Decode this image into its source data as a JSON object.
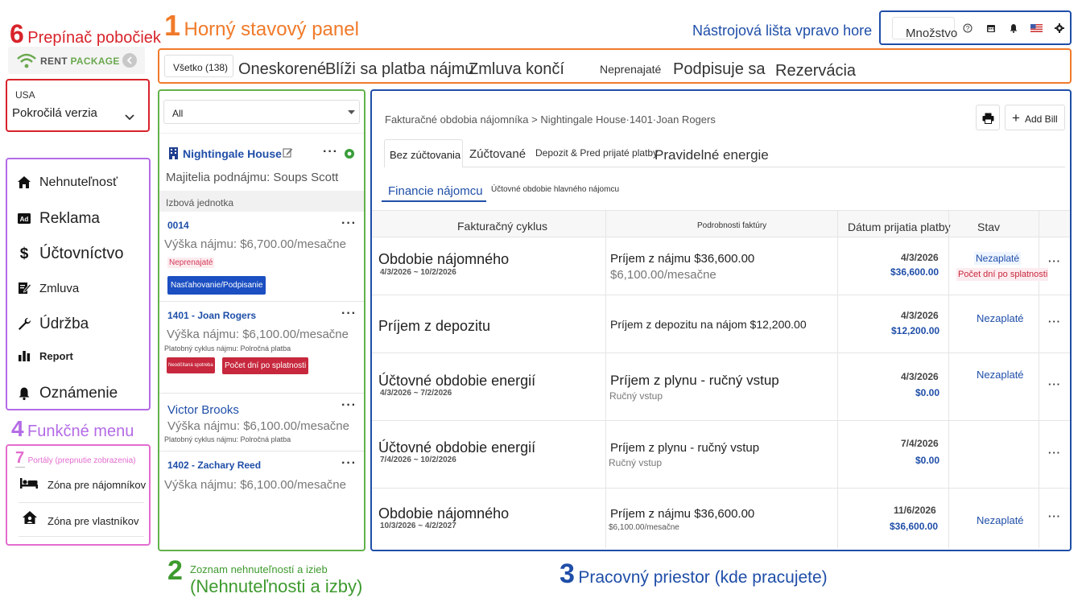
{
  "annotations": {
    "a1": {
      "num": "1",
      "text": "Horný stavový panel"
    },
    "a2": {
      "num": "2",
      "text_small": "Zoznam nehnuteľností a izieb",
      "text_large": "(Nehnuteľnosti a izby)"
    },
    "a3": {
      "num": "3",
      "text": "Pracovný priestor (kde pracujete)"
    },
    "a4": {
      "num": "4",
      "text": "Funkčné menu"
    },
    "a6": {
      "num": "6",
      "text": "Prepínač pobočiek"
    },
    "a7": {
      "num": "7",
      "text": "Portály (prepnutie zobrazenia)"
    },
    "toolbar_label": "Nástrojová lišta vpravo hore"
  },
  "colors": {
    "orange": "#f07a2a",
    "red": "#d8232a",
    "purple": "#b46be6",
    "pink": "#e36ccf",
    "green": "#3e9a2e",
    "blue": "#1f4ea8",
    "badge_blue": "#1b4fc2",
    "badge_red": "#c7283d"
  },
  "logo": {
    "text_dark": "RENT",
    "text_green": "PACKAGE"
  },
  "branch": {
    "country": "USA",
    "version": "Pokročilá verzia"
  },
  "toolbar": {
    "quantity_label": "Množstvo"
  },
  "menu": {
    "items": [
      {
        "label": "Nehnuteľnosť",
        "icon": "home-icon"
      },
      {
        "label": "Reklama",
        "icon": "ad-icon"
      },
      {
        "label": "Účtovníctvo",
        "icon": "dollar-icon"
      },
      {
        "label": "Zmluva",
        "icon": "contract-icon"
      },
      {
        "label": "Údržba",
        "icon": "wrench-icon"
      },
      {
        "label": "Report",
        "icon": "bar-chart-icon"
      },
      {
        "label": "Oznámenie",
        "icon": "bell-icon"
      }
    ]
  },
  "portals": {
    "tenant_zone": "Zóna pre nájomníkov",
    "owner_zone": "Zóna pre vlastníkov"
  },
  "status_bar": {
    "all_label": "Všetko",
    "all_count": "(138)",
    "overdue": "Oneskorené",
    "rent_due": "Blíži sa platba nájmu",
    "contract_ends": "Zmluva končí",
    "unrented": "Neprenajaté",
    "signing": "Podpisuje sa",
    "reservation": "Rezervácia"
  },
  "property_list": {
    "filter_value": "All",
    "property_name": "Nightingale House",
    "owner_line": "Majitelia podnájmu: Soups Scott",
    "section_label": "Izbová jednotka",
    "units": [
      {
        "name": "0014",
        "rent": "Výška nájmu: $6,700.00/mesačne",
        "tag": "Neprenajaté",
        "badge": "Nasťahovanie/Podpisanie"
      },
      {
        "name": "1401 - Joan Rogers",
        "rent": "Výška nájmu: $6,100.00/mesačne",
        "cycle": "Platobný cyklus nájmu: Polročná platba",
        "badge1": "Neodčítaná spotreba",
        "badge2": "Počet dní po splatnosti"
      },
      {
        "name": "Victor Brooks",
        "rent": "Výška nájmu: $6,100.00/mesačne",
        "cycle": "Platobný cyklus nájmu: Polročná platba"
      },
      {
        "name": "1402 - Zachary Reed",
        "rent": "Výška nájmu: $6,100.00/mesačne"
      }
    ]
  },
  "workspace": {
    "breadcrumb": "Fakturačné obdobia nájomníka > Nightingale House·1401·Joan Rogers",
    "add_bill": "Add Bill",
    "tabs": [
      "Bez zúčtovania",
      "Zúčtované",
      "Depozit & Pred prijaté platby",
      "Pravidelné energie"
    ],
    "subtabs": [
      "Financie nájomcu",
      "Účtovné obdobie hlavného nájomcu"
    ],
    "columns": [
      "Fakturačný cyklus",
      "Podrobnosti faktúry",
      "Dátum prijatia platby",
      "Stav"
    ],
    "rows": [
      {
        "cycle": "Obdobie nájomného",
        "range": "4/3/2026 ~ 10/2/2026",
        "detail": "Príjem z nájmu $36,600.00",
        "detail_sub": "$6,100.00/mesačne",
        "date": "4/3/2026",
        "amount": "$36,600.00",
        "status": "Nezaplaté",
        "status_extra": "Počet dní po splatnosti"
      },
      {
        "cycle": "Príjem z depozitu",
        "range": "",
        "detail": "Príjem z depozitu na nájom $12,200.00",
        "detail_sub": "",
        "date": "4/3/2026",
        "amount": "$12,200.00",
        "status": "Nezaplaté"
      },
      {
        "cycle": "Účtovné obdobie energií",
        "range": "4/3/2026 ~ 7/2/2026",
        "detail": "Príjem z plynu - ručný vstup",
        "detail_sub": "Ručný vstup",
        "date": "4/3/2026",
        "amount": "$0.00",
        "status": "Nezaplaté"
      },
      {
        "cycle": "Účtovné obdobie energií",
        "range": "7/4/2026 ~ 10/2/2026",
        "detail": "Príjem z plynu - ručný vstup",
        "detail_sub": "Ručný vstup",
        "date": "7/4/2026",
        "amount": "$0.00",
        "status": ""
      },
      {
        "cycle": "Obdobie nájomného",
        "range": "10/3/2026 ~ 4/2/2027",
        "detail": "Príjem z nájmu $36,600.00",
        "detail_sub": "$6,100.00/mesačne",
        "date": "11/6/2026",
        "amount": "$36,600.00",
        "status": "Nezaplaté"
      }
    ]
  }
}
